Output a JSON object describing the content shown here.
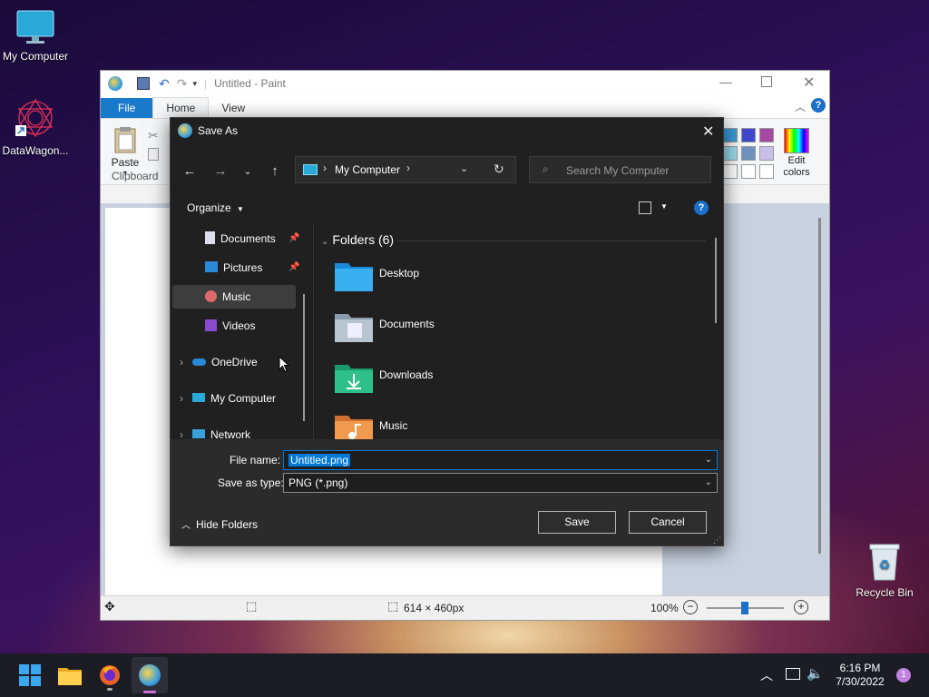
{
  "desktop": {
    "icons": [
      {
        "label": "My Computer"
      },
      {
        "label": "DataWagon..."
      },
      {
        "label": "Recycle Bin"
      }
    ]
  },
  "paint": {
    "title": "Untitled - Paint",
    "tabs": [
      "File",
      "Home",
      "View"
    ],
    "ribbon": {
      "paste_label": "Paste",
      "clipboard_label": "Clipboard",
      "edit_colors_label": "Edit colors"
    },
    "status": {
      "canvas_size": "614 × 460px",
      "zoom": "100%"
    }
  },
  "dialog": {
    "title": "Save As",
    "address": {
      "location": "My Computer"
    },
    "search_placeholder": "Search My Computer",
    "organize_label": "Organize",
    "nav_items": [
      {
        "label": "Documents",
        "pinned": true
      },
      {
        "label": "Pictures",
        "pinned": true
      },
      {
        "label": "Music",
        "selected": true
      },
      {
        "label": "Videos"
      },
      {
        "label": "OneDrive"
      },
      {
        "label": "My Computer"
      },
      {
        "label": "Network"
      }
    ],
    "group_header": "Folders (6)",
    "folders": [
      {
        "name": "Desktop"
      },
      {
        "name": "Documents"
      },
      {
        "name": "Downloads"
      },
      {
        "name": "Music"
      }
    ],
    "file_name_label": "File name:",
    "file_name_value": "Untitled.png",
    "save_type_label": "Save as type:",
    "save_type_value": "PNG (*.png)",
    "hide_folders_label": "Hide Folders",
    "save_label": "Save",
    "cancel_label": "Cancel"
  },
  "taskbar": {
    "time": "6:16 PM",
    "date": "7/30/2022",
    "notification_count": "1"
  },
  "colors": {
    "accent": "#0078d4",
    "dialog_bg": "#202020",
    "selection": "#0078d7"
  }
}
